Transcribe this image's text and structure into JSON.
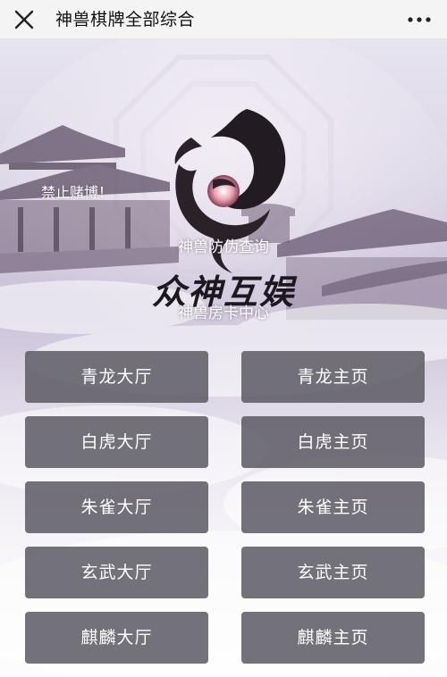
{
  "header": {
    "title": "神兽棋牌全部综合",
    "close_icon": "close-icon",
    "more_icon": "more-dots-icon"
  },
  "banner": {
    "notice": "禁止赌博！",
    "verify_link": "神兽防伪查询",
    "brand": "众神互娱",
    "card_center_link": "神兽房卡中心",
    "logo_icon": "swirl-logo-icon"
  },
  "buttons": [
    {
      "label": "青龙大厅"
    },
    {
      "label": "青龙主页"
    },
    {
      "label": "白虎大厅"
    },
    {
      "label": "白虎主页"
    },
    {
      "label": "朱雀大厅"
    },
    {
      "label": "朱雀主页"
    },
    {
      "label": "玄武大厅"
    },
    {
      "label": "玄武主页"
    },
    {
      "label": "麒麟大厅"
    },
    {
      "label": "麒麟主页"
    }
  ],
  "colors": {
    "button_bg": "#605d66",
    "button_text": "#ffffff",
    "topbar_bg": "#f4f4f4"
  }
}
